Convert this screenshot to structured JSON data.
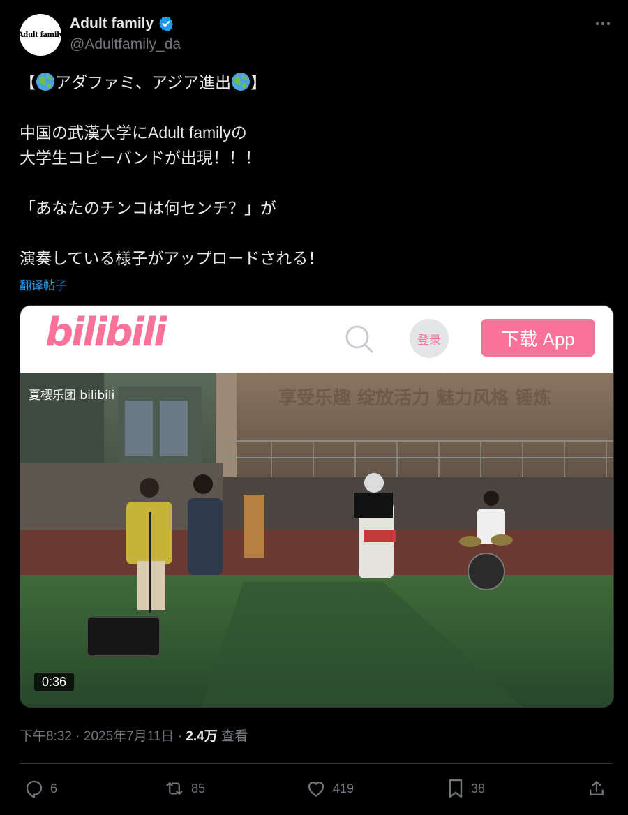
{
  "author": {
    "avatar_text": "Adult family",
    "display_name": "Adult family",
    "handle": "@Adultfamily_da"
  },
  "tweet": {
    "line1": "アダファミ、アジア進出",
    "line1_open": "【",
    "line1_close": "】",
    "line2": "中国の武漢大学にAdult familyの",
    "line3": "大学生コピーバンドが出現！！！",
    "line4": "「あなたのチンコは何センチ？」が",
    "line5": "演奏している様子がアップロードされる！",
    "translate_label": "翻译帖子"
  },
  "media": {
    "bili_logo": "bilibili",
    "login_label": "登录",
    "download_label": "下载 App",
    "watermark": "夏樱乐团 bilibili",
    "banner_text": "享受乐趣  绽放活力  魅力风格  锤炼",
    "duration": "0:36"
  },
  "meta": {
    "time": "下午8:32",
    "date": "2025年7月11日",
    "views_count": "2.4万",
    "views_label": "查看",
    "separator": " · "
  },
  "actions": {
    "replies": "6",
    "retweets": "85",
    "likes": "419",
    "bookmarks": "38"
  },
  "colors": {
    "background": "#000000",
    "text": "#e7e9ea",
    "muted": "#71767b",
    "accent": "#1d9bf0",
    "bili_pink": "#fb7299"
  },
  "icons": [
    "verified-badge-icon",
    "more-icon",
    "globe-icon",
    "search-icon",
    "reply-icon",
    "retweet-icon",
    "like-icon",
    "bookmark-icon",
    "share-icon"
  ]
}
